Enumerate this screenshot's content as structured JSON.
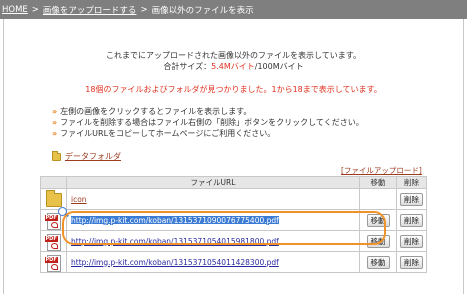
{
  "breadcrumb": {
    "home": "HOME",
    "upload": "画像をアップロードする",
    "current": "画像以外のファイルを表示",
    "separator": ">"
  },
  "summary": {
    "line1": "これまでにアップロードされた画像以外のファイルを表示しています。",
    "total_label": "合計サイズ：",
    "total_used": "5.4Mバイト",
    "total_max": "/100Mバイト"
  },
  "found_message": "18個のファイルおよびフォルダが見つかりました。1から18まで表示しています。",
  "notes": [
    "左側の画像をクリックするとファイルを表示します。",
    "ファイルを削除する場合はファイル右側の「削除」ボタンをクリックしてください。",
    "ファイルURLをコピーしてホームページにご利用ください。"
  ],
  "note_arrow": "»",
  "data_folder_label": "データフォルダ",
  "upload_link": "[ファイルアップロード]",
  "table": {
    "headers": {
      "url": "ファイルURL",
      "move": "移動",
      "delete": "削除"
    },
    "rows": [
      {
        "type": "folder",
        "icon": "folder-icon",
        "name": "icon",
        "delete": "削除"
      },
      {
        "type": "pdf",
        "icon": "pdf-icon",
        "url": "http://img.p-kit.com/koban/1315371090076775400.pdf",
        "move": "移動",
        "delete": "削除"
      },
      {
        "type": "pdf",
        "icon": "pdf-icon",
        "url": "http://img.p-kit.com/koban/1315371054015981800.pdf",
        "move": "移動",
        "delete": "削除"
      },
      {
        "type": "pdf",
        "icon": "pdf-icon",
        "url": "http://img.p-kit.com/koban/1315371054011428300.pdf",
        "move": "移動",
        "delete": "削除"
      }
    ]
  },
  "pdf_tag": "PDF",
  "colors": {
    "accent_red": "#e0301e",
    "highlight_orange": "#f0922a",
    "selection_blue": "#3b7bd4",
    "breadcrumb_bg": "#7f7f7f"
  }
}
